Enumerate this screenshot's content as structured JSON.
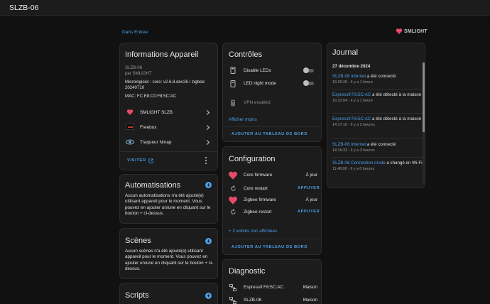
{
  "app": {
    "title": "SLZB-06"
  },
  "breadcrumb": "Dans Entree",
  "brand": {
    "name": "SMLIGHT",
    "color": "#e94a6b"
  },
  "device_info": {
    "title": "Informations Appareil",
    "model": "SLZB-06",
    "maker": "par SMLIGHT",
    "firmware_line1": "Micrologiciel : core: v2.6.8.dev26 / zigbee:",
    "firmware_line2": "20240710",
    "mac": "MAC: FC:E8:C0:F8:5C:AC",
    "integrations": [
      {
        "label": "SMLIGHT SLZB",
        "icon": "smlight-logo-icon"
      },
      {
        "label": "Freebox",
        "icon": "freebox-logo-icon"
      },
      {
        "label": "Traqueur Nmap",
        "icon": "nmap-eye-icon"
      }
    ],
    "visit_label": "VISITER"
  },
  "controls": {
    "title": "Contrôles",
    "items": [
      {
        "label": "Disable LEDs",
        "icon": "phone-led-icon",
        "state": "off"
      },
      {
        "label": "LED night mode",
        "icon": "led-night-icon",
        "state": "off"
      },
      {
        "label": "VPN enabled",
        "icon": "vpn-icon",
        "state": "disabled"
      }
    ],
    "show_less": "Afficher moins",
    "add_dashboard": "AJOUTER AU TABLEAU DE BORD"
  },
  "configuration": {
    "title": "Configuration",
    "items": [
      {
        "label": "Core firmware",
        "icon": "smlight-firmware-icon",
        "value": "À jour"
      },
      {
        "label": "Core restart",
        "icon": "restart-icon",
        "value": "APPUYER"
      },
      {
        "label": "Zigbee firmware",
        "icon": "smlight-firmware-icon",
        "value": "À jour"
      },
      {
        "label": "Zigbee restart",
        "icon": "restart-icon",
        "value": "APPUYER"
      }
    ],
    "hidden_entities": "+ 2 entités non affichées",
    "add_dashboard": "AJOUTER AU TABLEAU DE BORD"
  },
  "diagnostic": {
    "title": "Diagnostic",
    "items": [
      {
        "label": "Espressif F8:5C:AC",
        "value": "Maison"
      },
      {
        "label": "SLZB-06",
        "value": "Maison"
      }
    ]
  },
  "automations": {
    "title": "Automatisations",
    "text": "Aucun automatisations n'a été ajouté(e) utilisant appareil pour le moment. Vous pouvez en ajouter un/une en cliquant sur le bouton + ci-dessus."
  },
  "scenes": {
    "title": "Scènes",
    "text": "Aucun scènes n'a été ajouté(e) utilisant appareil pour le moment. Vous pouvez en ajouter un/une en cliquant sur le bouton + ci-dessus."
  },
  "scripts": {
    "title": "Scripts"
  },
  "journal": {
    "title": "Journal",
    "date": "27 décembre 2024",
    "entries": [
      {
        "link": "SLZB-06 Internet",
        "text": " a été connecté",
        "time": "16:25:28 - Il y a 1 heure"
      },
      {
        "link": "Espressif F8:5C:AC",
        "text": " a été détecté à la maison",
        "time": "16:22:04 - Il y a 1 heure"
      },
      {
        "link": "Espressif F8:5C:AC",
        "text": " a été détecté à la maison",
        "time": "14:17:10 - Il y a 3 heures"
      },
      {
        "link": "SLZB-06 Internet",
        "text": " a été connecté",
        "time": "14:16:33 - Il y a 3 heures"
      },
      {
        "link": "SLZB-06 Connection mode",
        "text": " a changé en Wi-Fi",
        "time": "11:48:00 - Il y a 6 heures"
      }
    ]
  }
}
